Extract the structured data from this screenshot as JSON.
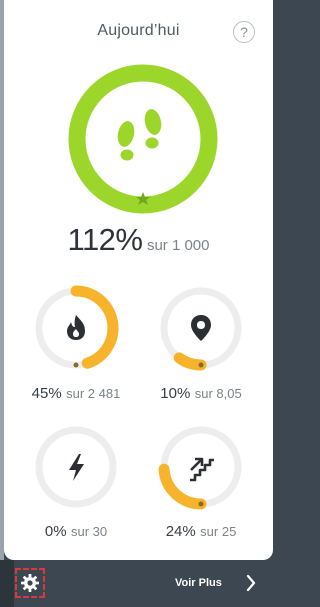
{
  "header": {
    "title": "Aujourd’hui",
    "help_icon_text": "?"
  },
  "steps": {
    "percent": "112%",
    "goal_text": "sur 1 000",
    "ring_color": "#9dd62b",
    "icon": "footprints-icon"
  },
  "stats": [
    {
      "id": "calories",
      "percent": "45%",
      "goal_text": "sur 2 481",
      "icon": "flame-icon",
      "progress": 0.45
    },
    {
      "id": "distance",
      "percent": "10%",
      "goal_text": "sur 8,05",
      "icon": "location-pin-icon",
      "progress": 0.1
    },
    {
      "id": "active-minutes",
      "percent": "0%",
      "goal_text": "sur 30",
      "icon": "lightning-icon",
      "progress": 0.0
    },
    {
      "id": "floors",
      "percent": "24%",
      "goal_text": "sur 25",
      "icon": "stairs-icon",
      "progress": 0.24
    }
  ],
  "colors": {
    "accent_green": "#9dd62b",
    "progress_yellow": "#f7b32b",
    "track_gray": "#ededed",
    "footer_bg": "#3d4752"
  },
  "footer": {
    "voir_plus_label": "Voir Plus",
    "settings_icon": "gear-icon",
    "chevron_icon": "chevron-right-icon"
  }
}
